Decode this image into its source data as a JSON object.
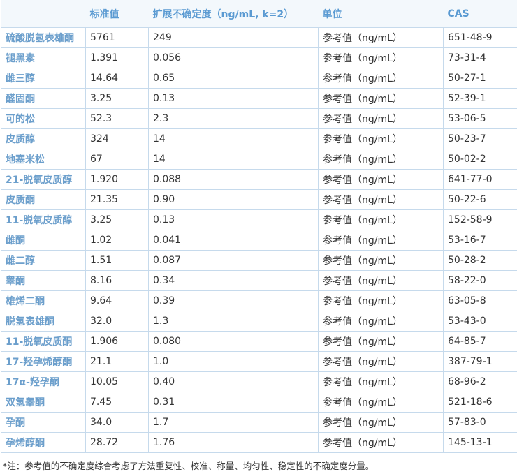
{
  "table": {
    "headers": [
      "",
      "标准值",
      "扩展不确定度（ng/mL, k=2）",
      "单位",
      "CAS"
    ],
    "rows": [
      [
        "硫酸脱氢表雄酮",
        "5761",
        "249",
        "参考值（ng/mL）",
        "651-48-9"
      ],
      [
        "褪黑素",
        "1.391",
        "0.056",
        "参考值（ng/mL）",
        "73-31-4"
      ],
      [
        "雌三醇",
        "14.64",
        "0.65",
        "参考值（ng/mL）",
        "50-27-1"
      ],
      [
        "醛固酮",
        "3.25",
        "0.13",
        "参考值（ng/mL）",
        "52-39-1"
      ],
      [
        "可的松",
        "52.3",
        "2.3",
        "参考值（ng/mL）",
        "53-06-5"
      ],
      [
        "皮质醇",
        "324",
        "14",
        "参考值（ng/mL）",
        "50-23-7"
      ],
      [
        "地塞米松",
        "67",
        "14",
        "参考值（ng/mL）",
        "50-02-2"
      ],
      [
        "21-脱氧皮质醇",
        "1.920",
        "0.088",
        "参考值（ng/mL）",
        "641-77-0"
      ],
      [
        "皮质酮",
        "21.35",
        "0.90",
        "参考值（ng/mL）",
        "50-22-6"
      ],
      [
        "11-脱氧皮质醇",
        "3.25",
        "0.13",
        "参考值（ng/mL）",
        "152-58-9"
      ],
      [
        "雌酮",
        "1.02",
        "0.041",
        "参考值（ng/mL）",
        "53-16-7"
      ],
      [
        "雌二醇",
        "1.51",
        "0.087",
        "参考值（ng/mL）",
        "50-28-2"
      ],
      [
        "睾酮",
        "8.16",
        "0.34",
        "参考值（ng/mL）",
        "58-22-0"
      ],
      [
        "雄烯二酮",
        "9.64",
        "0.39",
        "参考值（ng/mL）",
        "63-05-8"
      ],
      [
        "脱氢表雄酮",
        "32.0",
        "1.3",
        "参考值（ng/mL）",
        "53-43-0"
      ],
      [
        "11-脱氧皮质酮",
        "1.906",
        "0.080",
        "参考值（ng/mL）",
        "64-85-7"
      ],
      [
        "17-羟孕烯醇酮",
        "21.1",
        "1.0",
        "参考值（ng/mL）",
        "387-79-1"
      ],
      [
        "17α-羟孕酮",
        "10.05",
        "0.40",
        "参考值（ng/mL）",
        "68-96-2"
      ],
      [
        "双氢睾酮",
        "7.45",
        "0.31",
        "参考值（ng/mL）",
        "521-18-6"
      ],
      [
        "孕酮",
        "34.0",
        "1.7",
        "参考值（ng/mL）",
        "57-83-0"
      ],
      [
        "孕烯醇酮",
        "28.72",
        "1.76",
        "参考值（ng/mL）",
        "145-13-1"
      ]
    ]
  },
  "note": "*注：参考值的不确定度综合考虑了方法重复性、校准、称量、均匀性、稳定性的不确定度分量。"
}
